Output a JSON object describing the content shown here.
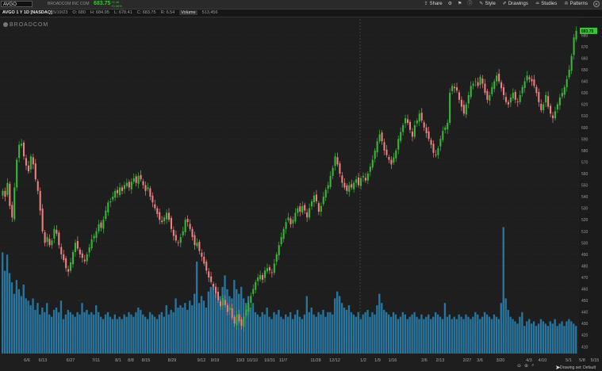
{
  "toolbar": {
    "symbol": "AVGO",
    "company": "BROADCOM INC COM",
    "last": "683.75",
    "change_lines": [
      "+2.48",
      "+0.36%",
      "A 683.75"
    ],
    "tools": [
      {
        "label": "Share",
        "icon": "share-icon",
        "glyph": "⇪"
      },
      {
        "label": "Style",
        "icon": "style-icon",
        "glyph": "✎"
      },
      {
        "label": "Drawings",
        "icon": "drawings-icon",
        "glyph": "✐"
      },
      {
        "label": "Studies",
        "icon": "studies-icon",
        "glyph": "♒"
      },
      {
        "label": "Patterns",
        "icon": "patterns-icon",
        "glyph": "♔"
      }
    ],
    "icon_buttons": [
      {
        "icon": "settings-icon",
        "glyph": "⚙"
      },
      {
        "icon": "flag-icon",
        "glyph": "⚑"
      },
      {
        "icon": "info-icon",
        "glyph": "ⓘ"
      }
    ],
    "close_glyph": "✕"
  },
  "info": {
    "title": "AVGO 1 Y 1D [NASDAQ]",
    "date": "D: 5/19/23",
    "open": "O: 680",
    "high": "H: 684.95",
    "low": "L: 678.41",
    "close": "C: 683.75",
    "range": "R: 6.54",
    "volume_label": "Volume",
    "volume": "513,456"
  },
  "logo": "BROADCOM",
  "footer": {
    "drawing_set": "Drawing set: Default"
  },
  "colors": {
    "up": "#37b837",
    "down": "#f08080",
    "volume": "#2b7da8",
    "price_tag": "#35c635"
  },
  "chart_data": {
    "type": "candlestick",
    "title": "AVGO 1 Y 1D [NASDAQ]",
    "ylim": [
      404,
      694
    ],
    "y_ticks": [
      410,
      420,
      430,
      440,
      450,
      460,
      470,
      480,
      490,
      500,
      510,
      520,
      530,
      540,
      550,
      560,
      570,
      580,
      590,
      600,
      610,
      620,
      630,
      640,
      650,
      660,
      670,
      680
    ],
    "last_price_tag": "683.75",
    "last_price": 683.75,
    "x_labels": [
      "6/6",
      "6/13",
      "6/27",
      "7/11",
      "8/1",
      "8/8",
      "8/15",
      "8/29",
      "9/12",
      "9/19",
      "10/3",
      "10/10",
      "10/31",
      "11/7",
      "11/28",
      "12/12",
      "1/2",
      "1/9",
      "1/16",
      "2/6",
      "2/13",
      "2/27",
      "3/6",
      "3/20",
      "4/3",
      "4/10",
      "5/1",
      "5/8",
      "5/15"
    ],
    "x_label_positions": [
      34,
      54,
      89,
      121,
      149,
      165,
      184,
      217,
      254,
      271,
      303,
      318,
      340,
      357,
      398,
      422,
      458,
      476,
      495,
      535,
      555,
      589,
      605,
      631,
      667,
      684,
      717,
      734,
      750
    ],
    "close_points": [
      [
        0,
        545
      ],
      [
        1,
        540
      ],
      [
        2,
        552
      ],
      [
        3,
        532
      ],
      [
        4,
        522
      ],
      [
        5,
        548
      ],
      [
        6,
        572
      ],
      [
        7,
        585
      ],
      [
        8,
        586
      ],
      [
        9,
        575
      ],
      [
        10,
        567
      ],
      [
        11,
        562
      ],
      [
        12,
        575
      ],
      [
        13,
        568
      ],
      [
        14,
        555
      ],
      [
        15,
        545
      ],
      [
        16,
        528
      ],
      [
        17,
        510
      ],
      [
        18,
        500
      ],
      [
        19,
        505
      ],
      [
        20,
        498
      ],
      [
        21,
        502
      ],
      [
        22,
        512
      ],
      [
        23,
        508
      ],
      [
        24,
        498
      ],
      [
        25,
        490
      ],
      [
        26,
        485
      ],
      [
        27,
        478
      ],
      [
        28,
        475
      ],
      [
        29,
        483
      ],
      [
        30,
        492
      ],
      [
        31,
        500
      ],
      [
        32,
        495
      ],
      [
        33,
        490
      ],
      [
        34,
        487
      ],
      [
        35,
        484
      ],
      [
        36,
        490
      ],
      [
        37,
        496
      ],
      [
        38,
        503
      ],
      [
        39,
        506
      ],
      [
        40,
        510
      ],
      [
        41,
        516
      ],
      [
        42,
        513
      ],
      [
        43,
        520
      ],
      [
        44,
        528
      ],
      [
        45,
        535
      ],
      [
        46,
        536
      ],
      [
        47,
        540
      ],
      [
        48,
        545
      ],
      [
        49,
        543
      ],
      [
        50,
        548
      ],
      [
        51,
        545
      ],
      [
        52,
        550
      ],
      [
        53,
        552
      ],
      [
        54,
        548
      ],
      [
        55,
        553
      ],
      [
        56,
        556
      ],
      [
        57,
        552
      ],
      [
        58,
        558
      ],
      [
        59,
        555
      ],
      [
        60,
        550
      ],
      [
        61,
        545
      ],
      [
        62,
        548
      ],
      [
        63,
        540
      ],
      [
        64,
        535
      ],
      [
        65,
        530
      ],
      [
        66,
        525
      ],
      [
        67,
        520
      ],
      [
        68,
        518
      ],
      [
        69,
        522
      ],
      [
        70,
        526
      ],
      [
        71,
        520
      ],
      [
        72,
        512
      ],
      [
        73,
        506
      ],
      [
        74,
        502
      ],
      [
        75,
        500
      ],
      [
        76,
        505
      ],
      [
        77,
        510
      ],
      [
        78,
        520
      ],
      [
        79,
        518
      ],
      [
        80,
        512
      ],
      [
        81,
        505
      ],
      [
        82,
        498
      ],
      [
        83,
        500
      ],
      [
        84,
        493
      ],
      [
        85,
        488
      ],
      [
        86,
        482
      ],
      [
        87,
        476
      ],
      [
        88,
        470
      ],
      [
        89,
        466
      ],
      [
        90,
        462
      ],
      [
        91,
        456
      ],
      [
        92,
        450
      ],
      [
        93,
        445
      ],
      [
        94,
        452
      ],
      [
        95,
        446
      ],
      [
        96,
        440
      ],
      [
        97,
        444
      ],
      [
        98,
        435
      ],
      [
        99,
        430
      ],
      [
        100,
        438
      ],
      [
        101,
        432
      ],
      [
        102,
        428
      ],
      [
        103,
        436
      ],
      [
        104,
        442
      ],
      [
        105,
        448
      ],
      [
        106,
        454
      ],
      [
        107,
        460
      ],
      [
        108,
        466
      ],
      [
        109,
        470
      ],
      [
        110,
        472
      ],
      [
        111,
        468
      ],
      [
        112,
        476
      ],
      [
        113,
        478
      ],
      [
        114,
        476
      ],
      [
        115,
        474
      ],
      [
        116,
        482
      ],
      [
        117,
        490
      ],
      [
        118,
        498
      ],
      [
        119,
        505
      ],
      [
        120,
        512
      ],
      [
        121,
        518
      ],
      [
        122,
        522
      ],
      [
        123,
        516
      ],
      [
        124,
        520
      ],
      [
        125,
        526
      ],
      [
        126,
        530
      ],
      [
        127,
        527
      ],
      [
        128,
        532
      ],
      [
        129,
        528
      ],
      [
        130,
        522
      ],
      [
        131,
        530
      ],
      [
        132,
        536
      ],
      [
        133,
        541
      ],
      [
        134,
        536
      ],
      [
        135,
        527
      ],
      [
        136,
        532
      ],
      [
        137,
        540
      ],
      [
        138,
        546
      ],
      [
        139,
        550
      ],
      [
        140,
        558
      ],
      [
        141,
        565
      ],
      [
        142,
        575
      ],
      [
        143,
        568
      ],
      [
        144,
        560
      ],
      [
        145,
        552
      ],
      [
        146,
        548
      ],
      [
        147,
        545
      ],
      [
        148,
        550
      ],
      [
        149,
        548
      ],
      [
        150,
        552
      ],
      [
        151,
        555
      ],
      [
        152,
        550
      ],
      [
        153,
        556
      ],
      [
        154,
        558
      ],
      [
        155,
        554
      ],
      [
        156,
        560
      ],
      [
        157,
        566
      ],
      [
        158,
        572
      ],
      [
        159,
        580
      ],
      [
        160,
        588
      ],
      [
        161,
        594
      ],
      [
        162,
        588
      ],
      [
        163,
        580
      ],
      [
        164,
        576
      ],
      [
        165,
        572
      ],
      [
        166,
        568
      ],
      [
        167,
        574
      ],
      [
        168,
        580
      ],
      [
        169,
        590
      ],
      [
        170,
        596
      ],
      [
        171,
        602
      ],
      [
        172,
        608
      ],
      [
        173,
        604
      ],
      [
        174,
        598
      ],
      [
        175,
        592
      ],
      [
        176,
        602
      ],
      [
        177,
        606
      ],
      [
        178,
        612
      ],
      [
        179,
        606
      ],
      [
        180,
        600
      ],
      [
        181,
        595
      ],
      [
        182,
        590
      ],
      [
        183,
        585
      ],
      [
        184,
        578
      ],
      [
        185,
        576
      ],
      [
        186,
        582
      ],
      [
        187,
        590
      ],
      [
        188,
        597
      ],
      [
        189,
        600
      ],
      [
        190,
        604
      ],
      [
        191,
        630
      ],
      [
        192,
        636
      ],
      [
        193,
        634
      ],
      [
        194,
        632
      ],
      [
        195,
        624
      ],
      [
        196,
        618
      ],
      [
        197,
        612
      ],
      [
        198,
        620
      ],
      [
        199,
        628
      ],
      [
        200,
        636
      ],
      [
        201,
        638
      ],
      [
        202,
        640
      ],
      [
        203,
        636
      ],
      [
        204,
        644
      ],
      [
        205,
        638
      ],
      [
        206,
        630
      ],
      [
        207,
        624
      ],
      [
        208,
        628
      ],
      [
        209,
        635
      ],
      [
        210,
        640
      ],
      [
        211,
        645
      ],
      [
        212,
        640
      ],
      [
        213,
        634
      ],
      [
        214,
        628
      ],
      [
        215,
        622
      ],
      [
        216,
        620
      ],
      [
        217,
        626
      ],
      [
        218,
        630
      ],
      [
        219,
        624
      ],
      [
        220,
        622
      ],
      [
        221,
        628
      ],
      [
        222,
        635
      ],
      [
        223,
        640
      ],
      [
        224,
        645
      ],
      [
        225,
        642
      ],
      [
        226,
        640
      ],
      [
        227,
        636
      ],
      [
        228,
        630
      ],
      [
        229,
        622
      ],
      [
        230,
        615
      ],
      [
        231,
        620
      ],
      [
        232,
        628
      ],
      [
        233,
        618
      ],
      [
        234,
        612
      ],
      [
        235,
        608
      ],
      [
        236,
        614
      ],
      [
        237,
        620
      ],
      [
        238,
        626
      ],
      [
        239,
        630
      ],
      [
        240,
        635
      ],
      [
        241,
        642
      ],
      [
        242,
        650
      ],
      [
        243,
        662
      ],
      [
        244,
        678
      ],
      [
        245,
        683.75
      ]
    ],
    "volume_values": [
      0.44,
      0.36,
      0.43,
      0.35,
      0.31,
      0.26,
      0.32,
      0.28,
      0.25,
      0.3,
      0.24,
      0.23,
      0.21,
      0.24,
      0.19,
      0.22,
      0.17,
      0.2,
      0.18,
      0.22,
      0.17,
      0.16,
      0.19,
      0.2,
      0.18,
      0.23,
      0.15,
      0.17,
      0.19,
      0.18,
      0.17,
      0.16,
      0.18,
      0.17,
      0.22,
      0.18,
      0.19,
      0.17,
      0.18,
      0.17,
      0.21,
      0.18,
      0.16,
      0.15,
      0.17,
      0.18,
      0.16,
      0.15,
      0.17,
      0.15,
      0.16,
      0.15,
      0.17,
      0.16,
      0.18,
      0.17,
      0.16,
      0.18,
      0.2,
      0.19,
      0.17,
      0.16,
      0.15,
      0.18,
      0.17,
      0.16,
      0.15,
      0.17,
      0.18,
      0.16,
      0.21,
      0.17,
      0.19,
      0.18,
      0.24,
      0.2,
      0.21,
      0.2,
      0.22,
      0.19,
      0.23,
      0.21,
      0.26,
      0.4,
      0.22,
      0.25,
      0.23,
      0.2,
      0.27,
      0.29,
      0.3,
      0.26,
      0.23,
      0.25,
      0.29,
      0.34,
      0.28,
      0.25,
      0.24,
      0.32,
      0.28,
      0.26,
      0.29,
      0.24,
      0.22,
      0.25,
      0.2,
      0.22,
      0.18,
      0.17,
      0.16,
      0.18,
      0.17,
      0.2,
      0.16,
      0.15,
      0.18,
      0.17,
      0.19,
      0.16,
      0.15,
      0.17,
      0.16,
      0.18,
      0.15,
      0.17,
      0.19,
      0.16,
      0.15,
      0.17,
      0.25,
      0.18,
      0.2,
      0.17,
      0.16,
      0.18,
      0.17,
      0.19,
      0.16,
      0.18,
      0.18,
      0.17,
      0.24,
      0.27,
      0.25,
      0.22,
      0.2,
      0.19,
      0.21,
      0.18,
      0.17,
      0.16,
      0.18,
      0.15,
      0.17,
      0.18,
      0.19,
      0.16,
      0.18,
      0.17,
      0.21,
      0.26,
      0.22,
      0.19,
      0.18,
      0.17,
      0.16,
      0.18,
      0.17,
      0.15,
      0.16,
      0.18,
      0.17,
      0.15,
      0.16,
      0.17,
      0.18,
      0.16,
      0.15,
      0.17,
      0.15,
      0.16,
      0.17,
      0.15,
      0.16,
      0.18,
      0.17,
      0.16,
      0.15,
      0.22,
      0.16,
      0.17,
      0.15,
      0.16,
      0.15,
      0.17,
      0.16,
      0.15,
      0.17,
      0.16,
      0.15,
      0.16,
      0.18,
      0.17,
      0.15,
      0.16,
      0.18,
      0.17,
      0.16,
      0.15,
      0.17,
      0.16,
      0.15,
      0.22,
      0.55,
      0.24,
      0.19,
      0.16,
      0.15,
      0.14,
      0.13,
      0.16,
      0.18,
      0.12,
      0.14,
      0.15,
      0.13,
      0.14,
      0.12,
      0.13,
      0.15,
      0.14,
      0.13,
      0.12,
      0.14,
      0.13,
      0.15,
      0.12,
      0.13,
      0.14,
      0.12,
      0.14,
      0.15,
      0.14,
      0.13,
      0.12,
      0.14,
      0.15,
      0.18,
      0.21,
      0.24,
      0.2
    ]
  }
}
